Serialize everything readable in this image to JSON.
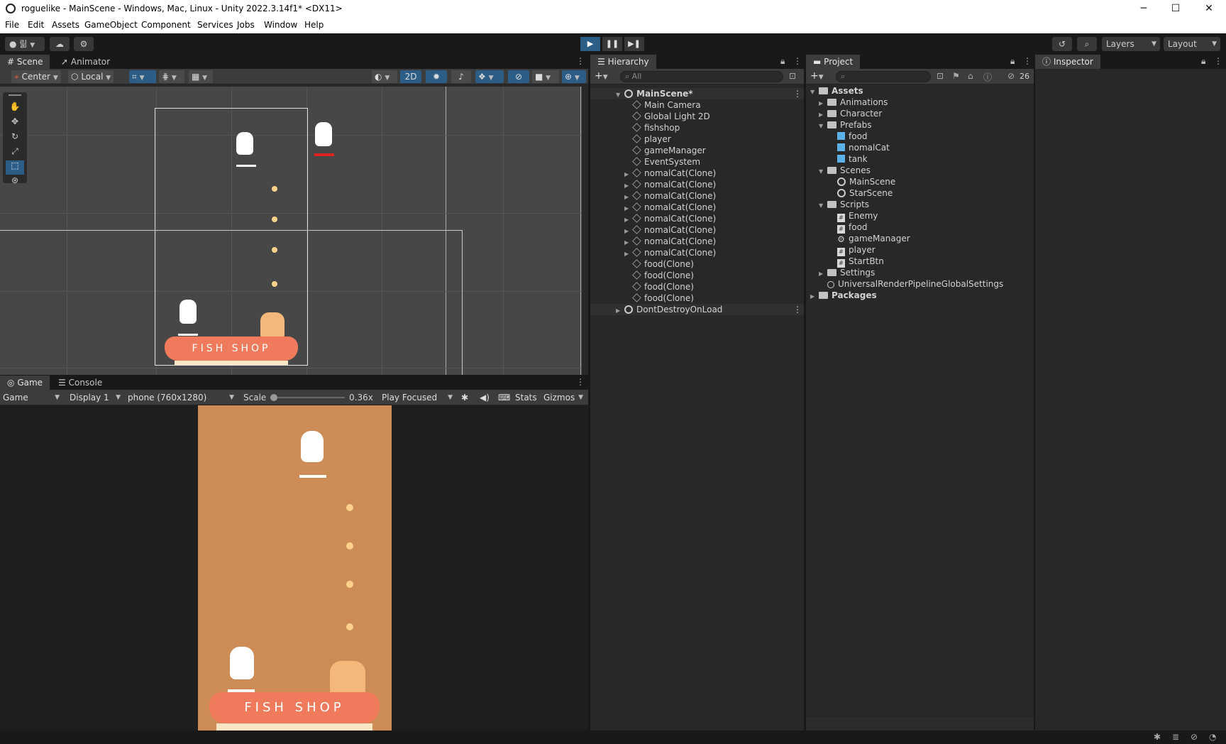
{
  "window": {
    "title": "roguelike - MainScene - Windows, Mac, Linux - Unity 2022.3.14f1* <DX11>",
    "minimize": "─",
    "maximize": "☐",
    "close": "✕"
  },
  "menu": [
    "File",
    "Edit",
    "Assets",
    "GameObject",
    "Component",
    "Services",
    "Jobs",
    "Window",
    "Help"
  ],
  "toolbar": {
    "account": "릶",
    "layers": "Layers",
    "layout": "Layout"
  },
  "scene_panel": {
    "tabs": [
      "Scene",
      "Animator"
    ],
    "pivot": "Center",
    "space": "Local",
    "mode_2d": "2D"
  },
  "game_panel": {
    "tabs": [
      "Game",
      "Console"
    ],
    "view": "Game",
    "display": "Display 1",
    "resolution": "phone (760x1280)",
    "scale_label": "Scale",
    "scale_value": "0.36x",
    "play_mode": "Play Focused",
    "stats": "Stats",
    "gizmos": "Gizmos",
    "shop_sign": "FISH   SHOP"
  },
  "hierarchy": {
    "tab": "Hierarchy",
    "search_placeholder": "All",
    "scene": "MainScene*",
    "items": [
      "Main Camera",
      "Global Light 2D",
      "fishshop",
      "player",
      "gameManager",
      "EventSystem",
      "nomalCat(Clone)",
      "nomalCat(Clone)",
      "nomalCat(Clone)",
      "nomalCat(Clone)",
      "nomalCat(Clone)",
      "nomalCat(Clone)",
      "nomalCat(Clone)",
      "nomalCat(Clone)",
      "food(Clone)",
      "food(Clone)",
      "food(Clone)",
      "food(Clone)"
    ],
    "dont_destroy": "DontDestroyOnLoad"
  },
  "project": {
    "tab": "Project",
    "hidden_count": "26",
    "root": "Assets",
    "folders": {
      "animations": "Animations",
      "character": "Character",
      "prefabs": "Prefabs",
      "prefab_items": [
        "food",
        "nomalCat",
        "tank"
      ],
      "scenes": "Scenes",
      "scene_items": [
        "MainScene",
        "StarScene"
      ],
      "scripts": "Scripts",
      "script_items": [
        "Enemy",
        "food",
        "gameManager",
        "player",
        "StartBtn"
      ],
      "settings": "Settings",
      "urp": "UniversalRenderPipelineGlobalSettings",
      "packages": "Packages"
    }
  },
  "inspector": {
    "tab": "Inspector"
  },
  "colors": {
    "game_bg": "#cd8c55",
    "shop_awning": "#f07a5c",
    "selection": "#2c5d87"
  }
}
